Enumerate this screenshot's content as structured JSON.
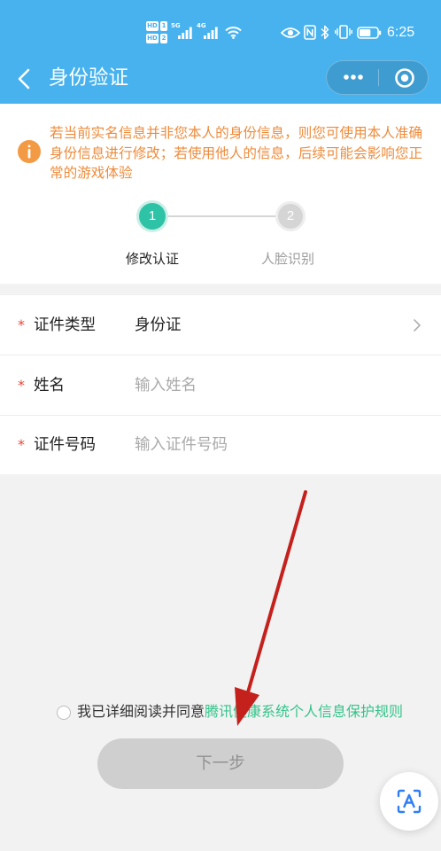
{
  "status_bar": {
    "sim1": {
      "hd": "HD",
      "slot": "1"
    },
    "sim2": {
      "hd": "HD",
      "slot": "2"
    },
    "network1": "5G",
    "network2": "4G",
    "time": "6:25",
    "battery_level": 0.65,
    "icons": [
      "signal-icon",
      "wifi-icon",
      "eye-comfort-icon",
      "nfc-icon",
      "bluetooth-icon",
      "vibrate-icon",
      "battery-icon"
    ]
  },
  "nav": {
    "title": "身份验证",
    "back_icon": "chevron-left-icon",
    "more_icon": "more-dots-icon",
    "exit_icon": "target-circle-icon"
  },
  "notice": {
    "icon": "info-icon",
    "text": "若当前实名信息并非您本人的身份信息，则您可使用本人准确身份信息进行修改；若使用他人的信息，后续可能会影响您正常的游戏体验"
  },
  "steps": [
    {
      "number": "1",
      "label": "修改认证",
      "active": true
    },
    {
      "number": "2",
      "label": "人脸识别",
      "active": false
    }
  ],
  "form": {
    "rows": [
      {
        "required_mark": "*",
        "label": "证件类型",
        "value": "身份证",
        "icon": "chevron-right-icon"
      },
      {
        "required_mark": "*",
        "label": "姓名",
        "value": "",
        "placeholder": "输入姓名"
      },
      {
        "required_mark": "*",
        "label": "证件号码",
        "value": "",
        "placeholder": "输入证件号码"
      }
    ]
  },
  "agreement": {
    "checked": false,
    "prefix": "我已详细阅读并同意",
    "link": "腾讯健康系统个人信息保护规则"
  },
  "next_button": {
    "label": "下一步",
    "enabled": false
  },
  "floating_button": {
    "icon": "text-recognition-icon"
  },
  "annotation": {
    "icon": "red-arrow-annotation"
  },
  "colors": {
    "header_bg": "#47b2ee",
    "notice_text": "#ee8b3b",
    "info_icon": "#f39a45",
    "step_active": "#2ec3a6",
    "step_inactive": "#d5d5d5",
    "required_mark": "#e5473a",
    "placeholder": "#aaaaaa",
    "link": "#34c48b",
    "button_disabled_bg": "#cfcfcf",
    "button_disabled_text": "#929292",
    "annotation_arrow": "#c4211d",
    "floating_icon": "#2f7ef5"
  }
}
